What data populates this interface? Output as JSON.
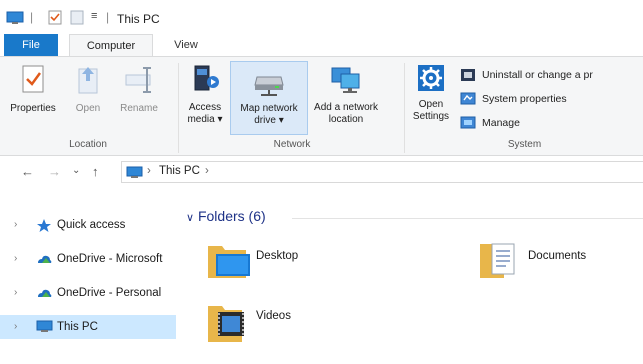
{
  "window": {
    "title": "This PC"
  },
  "qat": {
    "separator": "|"
  },
  "tabs": {
    "file": "File",
    "computer": "Computer",
    "view": "View"
  },
  "ribbon": {
    "location": {
      "label": "Location",
      "properties": "Properties",
      "open": "Open",
      "rename": "Rename"
    },
    "network": {
      "label": "Network",
      "access_media_1": "Access",
      "access_media_2": "media ▾",
      "map_drive_1": "Map network",
      "map_drive_2": "drive ▾",
      "add_location_1": "Add a network",
      "add_location_2": "location"
    },
    "system": {
      "label": "System",
      "open_settings_1": "Open",
      "open_settings_2": "Settings",
      "uninstall": "Uninstall or change a pr",
      "system_properties": "System properties",
      "manage": "Manage"
    }
  },
  "address": {
    "back": "←",
    "forward": "→",
    "recent": "⌄",
    "up": "↑",
    "sep1": "›",
    "crumb": "This PC",
    "sep2": "›"
  },
  "nav": {
    "chevron": "›",
    "items": [
      {
        "label": "Quick access"
      },
      {
        "label": "OneDrive - Microsoft"
      },
      {
        "label": "OneDrive - Personal"
      },
      {
        "label": "This PC"
      }
    ]
  },
  "content": {
    "group_header": "Folders (6)",
    "group_chevron": "∨",
    "folders": [
      {
        "name": "Desktop"
      },
      {
        "name": "Documents"
      },
      {
        "name": "Videos"
      }
    ]
  },
  "colors": {
    "accent": "#1979ca",
    "selection": "#cce8ff",
    "ribbon_bg": "#f5f6f7",
    "group_header": "#1e3287"
  }
}
